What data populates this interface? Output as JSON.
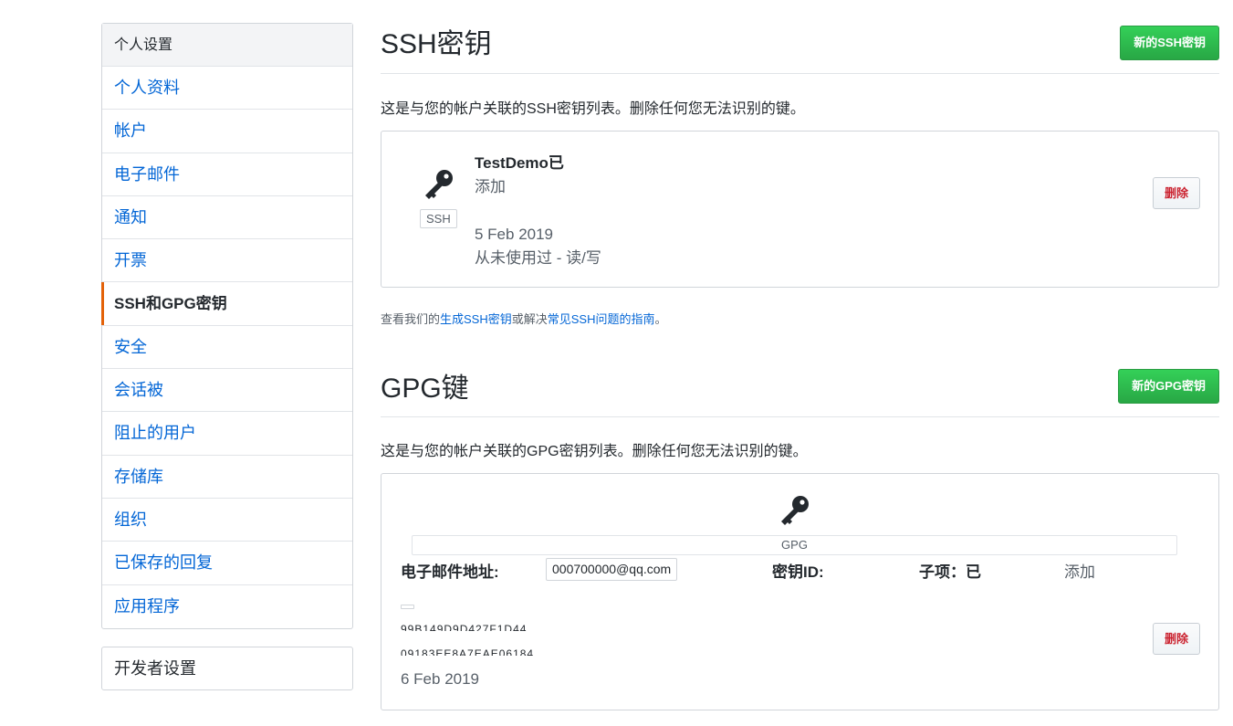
{
  "sidebar": {
    "heading": "个人设置",
    "items": [
      {
        "label": "个人资料"
      },
      {
        "label": "帐户"
      },
      {
        "label": "电子邮件"
      },
      {
        "label": "通知"
      },
      {
        "label": "开票"
      },
      {
        "label": "SSH和GPG密钥",
        "selected": true
      },
      {
        "label": "安全"
      },
      {
        "label": "会话被"
      },
      {
        "label": "阻止的用户"
      },
      {
        "label": "存储库"
      },
      {
        "label": "组织"
      },
      {
        "label": "已保存的回复"
      },
      {
        "label": "应用程序"
      }
    ],
    "developer": "开发者设置"
  },
  "ssh": {
    "title": "SSH密钥",
    "new_button": "新的SSH密钥",
    "description": "这是与您的帐户关联的SSH密钥列表。删除任何您无法识别的键。",
    "key": {
      "icon": "key-icon",
      "type": "SSH",
      "title": "TestDemo已",
      "added": "添加",
      "date": "5 Feb 2019",
      "usage": "从未使用过 - 读/写",
      "delete_label": "删除"
    },
    "help": {
      "prefix": "查看我们的",
      "link1": "生成SSH密钥",
      "middle": "或解决",
      "link2": "常见SSH问题的指南",
      "suffix": "。"
    }
  },
  "gpg": {
    "title": "GPG键",
    "new_button": "新的GPG密钥",
    "description": "这是与您的帐户关联的GPG密钥列表。删除任何您无法识别的键。",
    "key": {
      "icon": "key-icon",
      "type": "GPG",
      "email_label": "电子邮件地址:",
      "email_value": "000700000@qq.com",
      "keyid_label": "密钥ID:",
      "subkey_label": "子项：已",
      "added": "添加",
      "line1": "99B149D9D427F1D44",
      "line2": "09183EE8A7EAE06184",
      "date": "6 Feb 2019",
      "delete_label": "删除"
    }
  },
  "colors": {
    "link": "#0366d6",
    "green": "#28a745",
    "danger": "#cb2431",
    "selected_bar": "#e36209"
  }
}
